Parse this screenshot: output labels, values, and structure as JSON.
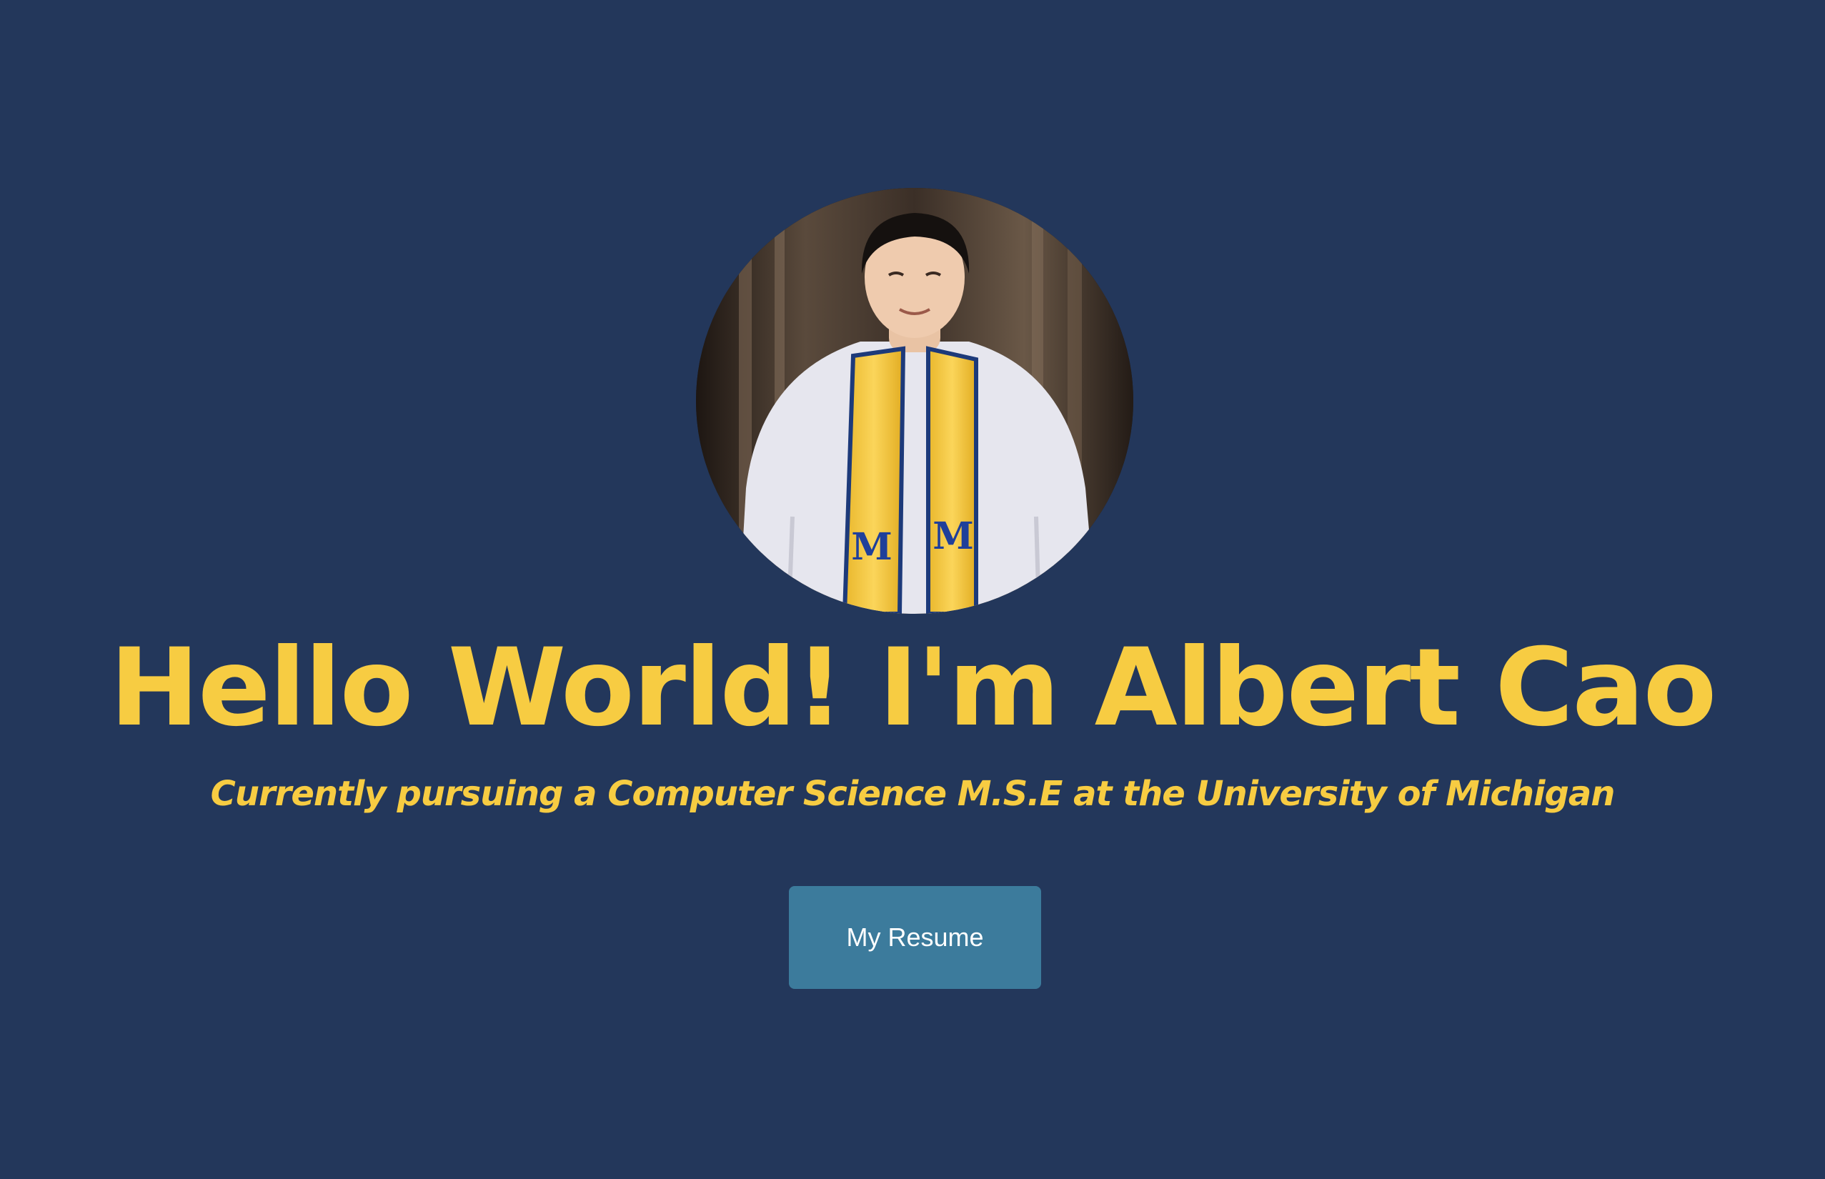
{
  "hero": {
    "headline": "Hello World! I'm Albert Cao",
    "subheadline": "Currently pursuing a Computer Science M.S.E at the University of Michigan",
    "resume_button_label": "My Resume",
    "avatar_stole_letter": "M"
  },
  "colors": {
    "background": "#23375b",
    "accent_yellow": "#f7cc42",
    "button": "#3c7b9c",
    "button_text": "#ffffff"
  }
}
